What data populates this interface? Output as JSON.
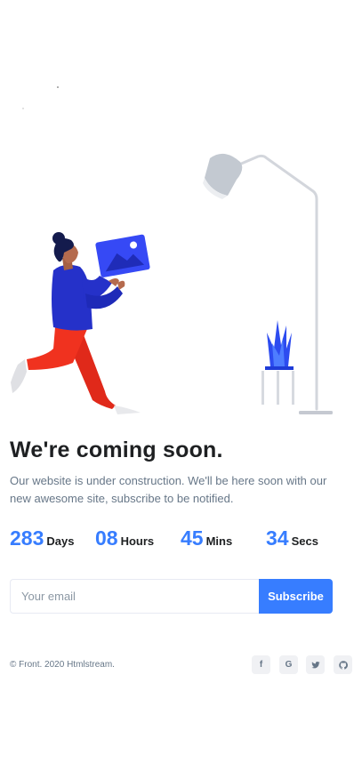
{
  "hero": {
    "title": "We're coming soon.",
    "description": "Our website is under construction. We'll be here soon with our new awesome site, subscribe to be notified."
  },
  "countdown": [
    {
      "value": "283",
      "label": "Days"
    },
    {
      "value": "08",
      "label": "Hours"
    },
    {
      "value": "45",
      "label": "Mins"
    },
    {
      "value": "34",
      "label": "Secs"
    }
  ],
  "subscribe": {
    "email_placeholder": "Your email",
    "button_label": "Subscribe"
  },
  "footer": {
    "copyright": "© Front. 2020 Htmlstream.",
    "social": [
      {
        "icon": "facebook-icon",
        "glyph": "f"
      },
      {
        "icon": "google-icon",
        "glyph": "G"
      },
      {
        "icon": "twitter-icon",
        "glyph": ""
      },
      {
        "icon": "github-icon",
        "glyph": ""
      }
    ]
  },
  "colors": {
    "primary": "#377dff",
    "text_dark": "#1e2022",
    "text_muted": "#677788",
    "illustration_blue": "#2d3edb",
    "illustration_red": "#e5301f"
  }
}
